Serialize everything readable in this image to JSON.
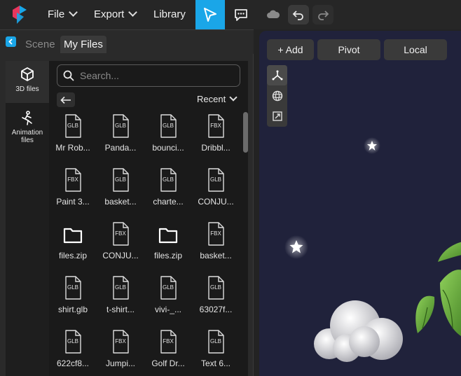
{
  "menu": {
    "file_label": "File",
    "export_label": "Export",
    "library_label": "Library"
  },
  "panel": {
    "tab_scene": "Scene",
    "tab_files": "My Files"
  },
  "sidenav": {
    "items": [
      {
        "label": "3D files",
        "icon": "cube-icon",
        "active": true
      },
      {
        "label": "Animation files",
        "icon": "running-figure-icon",
        "active": false
      }
    ]
  },
  "files": {
    "search_placeholder": "Search...",
    "sort_label": "Recent",
    "items": [
      {
        "type": "GLB",
        "name": "Mr Rob..."
      },
      {
        "type": "GLB",
        "name": "Panda..."
      },
      {
        "type": "GLB",
        "name": "bounci..."
      },
      {
        "type": "FBX",
        "name": "Dribbl..."
      },
      {
        "type": "FBX",
        "name": "Paint 3..."
      },
      {
        "type": "GLB",
        "name": "basket..."
      },
      {
        "type": "GLB",
        "name": "charte..."
      },
      {
        "type": "GLB",
        "name": "CONJU..."
      },
      {
        "type": "folder",
        "name": "files.zip"
      },
      {
        "type": "FBX",
        "name": "CONJU..."
      },
      {
        "type": "folder",
        "name": "files.zip"
      },
      {
        "type": "FBX",
        "name": "basket..."
      },
      {
        "type": "GLB",
        "name": "shirt.glb"
      },
      {
        "type": "GLB",
        "name": "t-shirt..."
      },
      {
        "type": "GLB",
        "name": "vivi-_..."
      },
      {
        "type": "GLB",
        "name": "63027f..."
      },
      {
        "type": "GLB",
        "name": "622cf8..."
      },
      {
        "type": "FBX",
        "name": "Jumpi..."
      },
      {
        "type": "FBX",
        "name": "Golf Dr..."
      },
      {
        "type": "GLB",
        "name": "Text 6..."
      }
    ]
  },
  "viewport": {
    "add_label": "+ Add",
    "pivot_label": "Pivot",
    "local_label": "Local",
    "background_color": "#20223b"
  },
  "colors": {
    "accent": "#1aa6e8"
  }
}
